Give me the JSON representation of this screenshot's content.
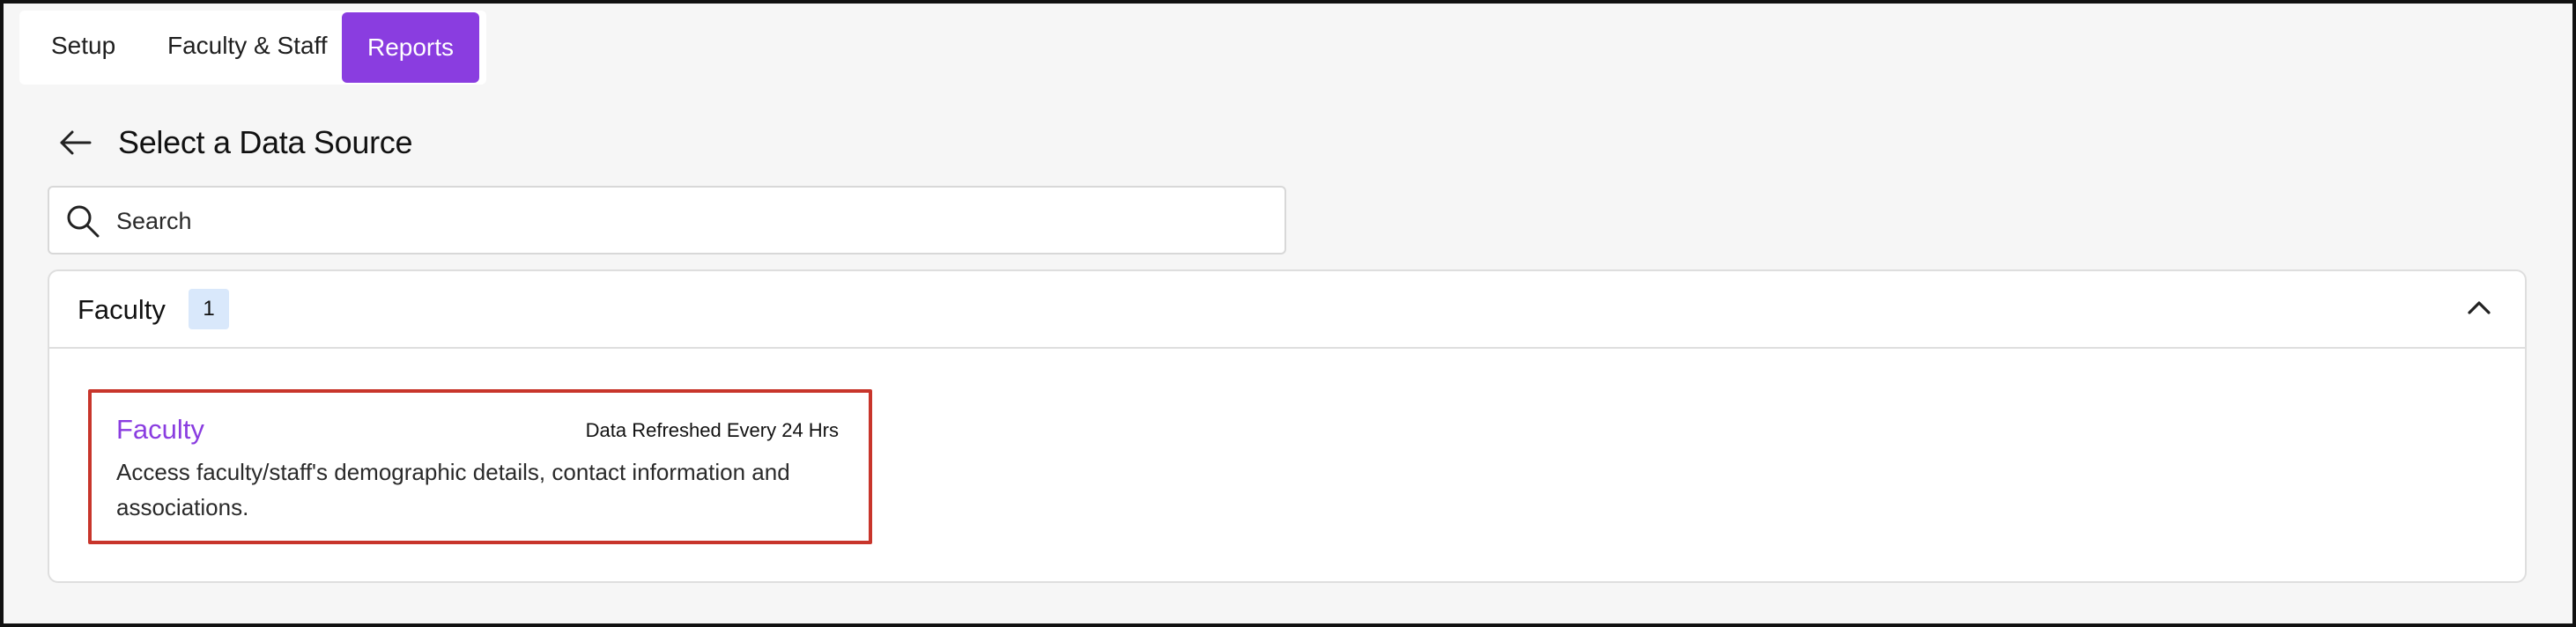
{
  "tabs": [
    {
      "label": "Setup"
    },
    {
      "label": "Faculty & Staff"
    },
    {
      "label": "Reports",
      "active": true
    }
  ],
  "header": {
    "title": "Select a Data Source",
    "back_icon": "arrow-left-icon"
  },
  "search": {
    "placeholder": "Search",
    "value": "",
    "icon": "search-icon"
  },
  "category": {
    "title": "Faculty",
    "count": "1",
    "expanded": true,
    "toggle_icon": "chevron-up-icon",
    "sources": [
      {
        "title": "Faculty",
        "refresh": "Data Refreshed Every 24 Hrs",
        "description": "Access faculty/staff's demographic details, contact information and associations."
      }
    ]
  },
  "colors": {
    "accent": "#8a3de0",
    "badge_bg": "#d9e8fb",
    "highlight_border": "#c8352b",
    "page_bg": "#f6f6f6"
  }
}
